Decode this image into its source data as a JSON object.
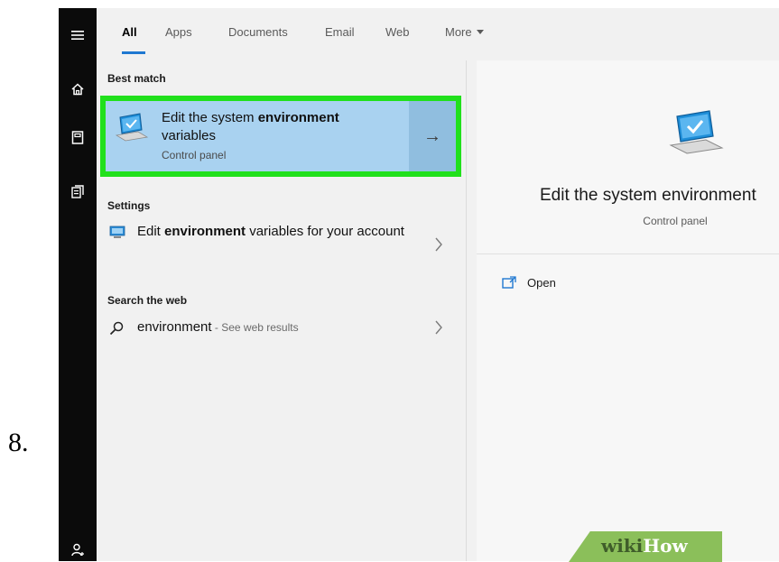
{
  "step_number": "8.",
  "tabs": [
    {
      "label": "All",
      "active": true
    },
    {
      "label": "Apps",
      "active": false
    },
    {
      "label": "Documents",
      "active": false
    },
    {
      "label": "Email",
      "active": false
    },
    {
      "label": "Web",
      "active": false
    },
    {
      "label": "More",
      "active": false
    }
  ],
  "left_rail": {
    "icons": [
      "hamburger-menu-icon",
      "home-icon",
      "notebook-icon",
      "documents-icon",
      "user-icon"
    ]
  },
  "results": {
    "best_match": {
      "header": "Best match",
      "title_prefix": "Edit the system ",
      "title_bold": "environment",
      "title_suffix": "variables",
      "subtitle": "Control panel",
      "arrow": "→",
      "icon": "system-monitor-icon",
      "highlight_color": "#21e01c"
    },
    "settings": {
      "header": "Settings",
      "item": {
        "prefix": "Edit ",
        "bold": "environment",
        "suffix": " variables for your account",
        "icon": "settings-monitor-icon"
      }
    },
    "web": {
      "header": "Search the web",
      "item": {
        "query": "environment",
        "suffix": " - See web results",
        "icon": "search-icon"
      }
    }
  },
  "preview": {
    "title": "Edit the system environment",
    "subtitle": "Control panel",
    "open_label": "Open",
    "icon": "system-monitor-icon"
  },
  "watermark": {
    "part1": "wiki",
    "part2": "How"
  },
  "colors": {
    "accent": "#1f78d1",
    "best_match_bg": "#a9d2f0",
    "rail_bg": "#0b0b0b"
  }
}
